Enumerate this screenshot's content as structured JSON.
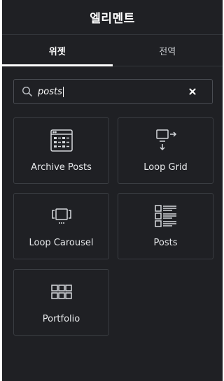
{
  "header": {
    "title": "엘리멘트"
  },
  "tabs": [
    {
      "label": "위젯",
      "active": true
    },
    {
      "label": "전역",
      "active": false
    }
  ],
  "search": {
    "value": "posts"
  },
  "widgets": [
    {
      "label": "Archive Posts",
      "icon": "archive-posts-icon"
    },
    {
      "label": "Loop Grid",
      "icon": "loop-grid-icon"
    },
    {
      "label": "Loop Carousel",
      "icon": "loop-carousel-icon"
    },
    {
      "label": "Posts",
      "icon": "posts-icon"
    },
    {
      "label": "Portfolio",
      "icon": "portfolio-icon"
    }
  ],
  "colors": {
    "background": "#1f2024",
    "border": "#3a3d42",
    "text": "#e6e8ea"
  }
}
